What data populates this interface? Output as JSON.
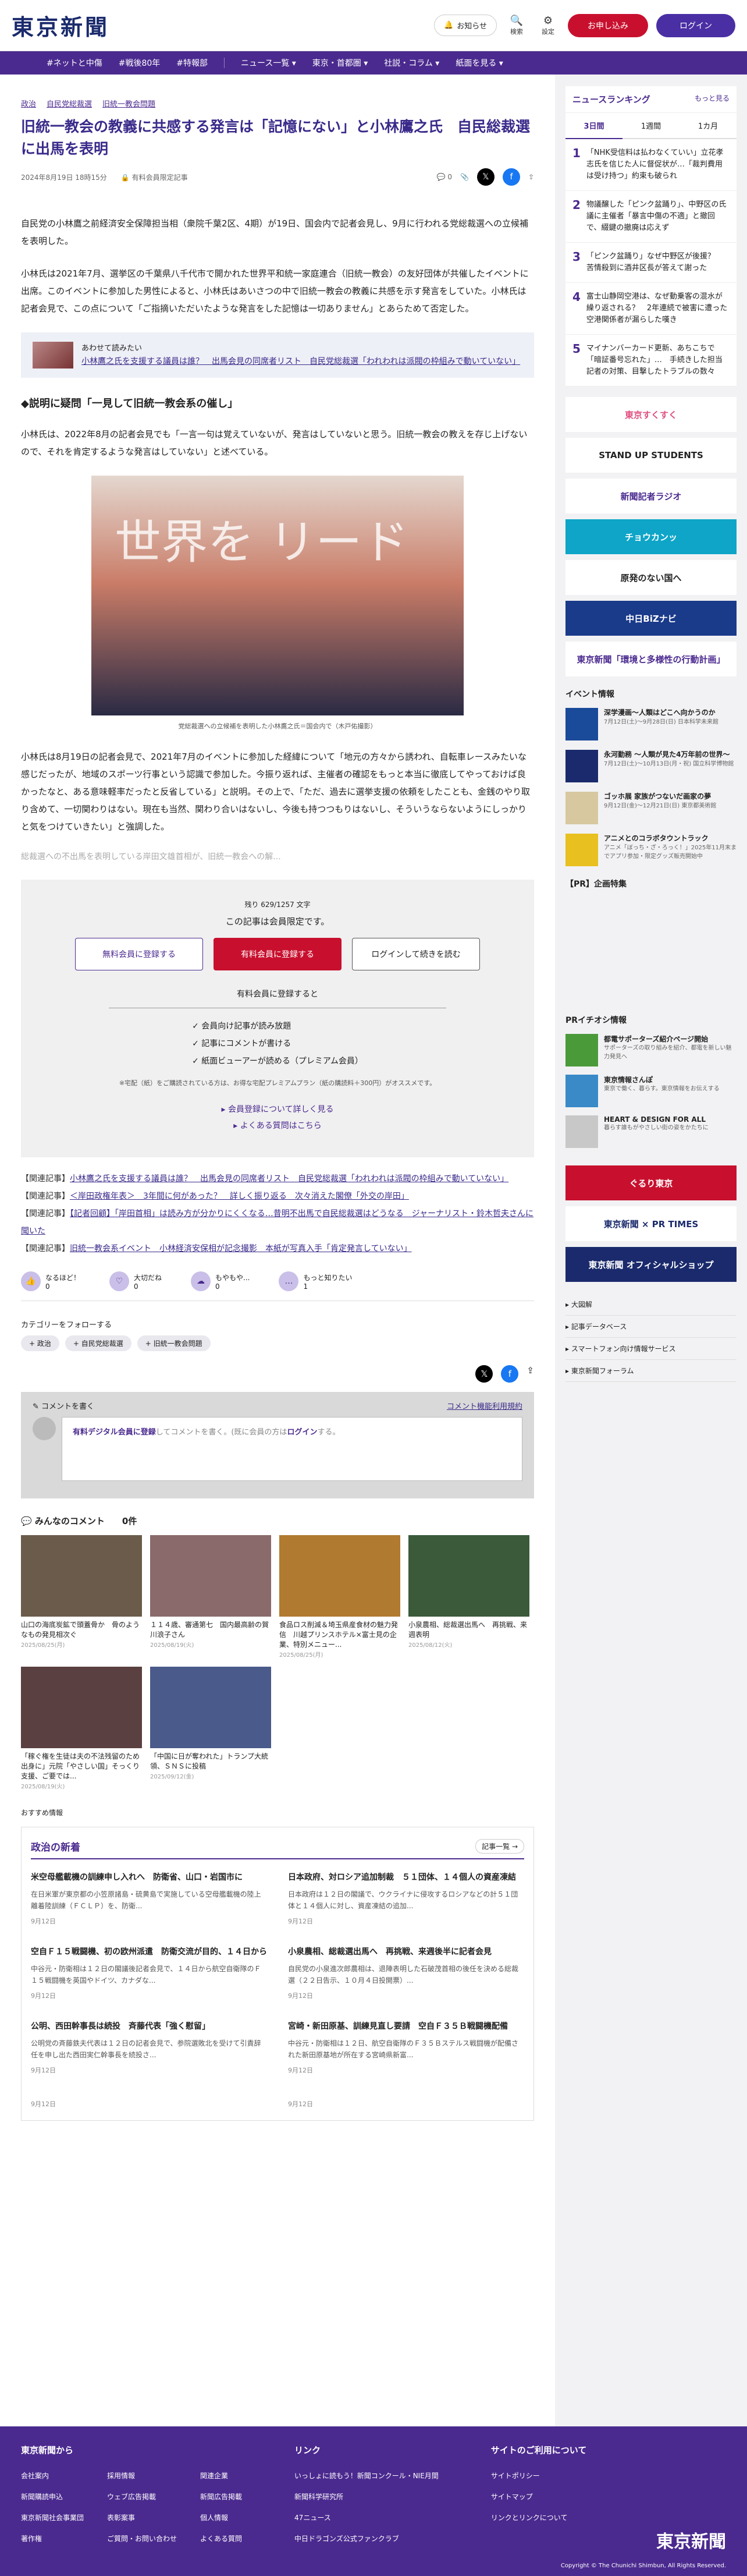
{
  "header": {
    "logo": "東京新聞",
    "notice_btn": "お知らせ",
    "search_label": "検索",
    "settings_label": "設定",
    "subscribe_btn": "お申し込み",
    "login_btn": "ログイン"
  },
  "nav": [
    "#ネットと中傷",
    "#戦後80年",
    "#特報部",
    "ニュース一覧 ▾",
    "東京・首都圏 ▾",
    "社説・コラム ▾",
    "紙面を見る ▾"
  ],
  "breadcrumb": [
    "政治",
    "自民党総裁選",
    "旧統一教会問題"
  ],
  "article": {
    "title": "旧統一教会の教義に共感する発言は「記憶にない」と小林鷹之氏　自民総裁選に出馬を表明",
    "date": "2024年8月19日 18時15分",
    "member_only": "有料会員限定記事",
    "comment_count": "0",
    "p1": "自民党の小林鷹之前経済安全保障担当相（衆院千葉2区、4期）が19日、国会内で記者会見し、9月に行われる党総裁選への立候補を表明した。",
    "p2": "小林氏は2021年7月、選挙区の千葉県八千代市で開かれた世界平和統一家庭連合（旧統一教会）の友好団体が共催したイベントに出席。このイベントに参加した男性によると、小林氏はあいさつの中で旧統一教会の教義に共感を示す発言をしていた。小林氏は記者会見で、この点について「ご指摘いただいたような発言をした記憶は一切ありません」とあらためて否定した。",
    "related_box_title": "あわせて読みたい",
    "related_box_link": "小林鷹之氏を支援する議員は誰？　出馬会見の同席者リスト　自民党総裁選「われわれは派閥の枠組みで動いていない」",
    "subhead": "◆説明に疑問「一見して旧統一教会系の催し」",
    "p3": "小林氏は、2022年8月の記者会見でも「一言一句は覚えていないが、発言はしていないと思う。旧統一教会の教えを存じ上げないので、それを肯定するような発言はしていない」と述べている。",
    "photo_text": "世界を リード",
    "caption": "党総裁選への立候補を表明した小林鷹之氏＝国会内で（木戸佑撮影）",
    "p4": "小林氏は8月19日の記者会見で、2021年7月のイベントに参加した経緯について「地元の方々から誘われ、自転車レースみたいな感じだったが、地域のスポーツ行事という認識で参加した。今振り返れば、主催者の確認をもっと本当に徹底してやっておけば良かったなと、ある意味軽率だったと反省している」と説明。その上で、「ただ、過去に選挙支援の依頼をしたことも、金銭のやり取り含めて、一切関わりはない。現在も当然、関わり合いはないし、今後も持つつもりはないし、そういうならないようにしっかりと気をつけていきたい」と強調した。",
    "fade": "総裁選への不出馬を表明している岸田文雄首相が、旧統一教会への解..."
  },
  "paywall": {
    "count": "残り 629/1257 文字",
    "title": "この記事は会員限定です。",
    "btn_free": "無料会員に登録する",
    "btn_paid": "有料会員に登録する",
    "btn_login": "ログインして続きを読む",
    "sub": "有料会員に登録すると",
    "benefits": [
      "✓ 会員向け記事が読み放題",
      "✓ 記事にコメントが書ける",
      "✓ 紙面ビューアーが読める（プレミアム会員）"
    ],
    "note": "※宅配（紙）をご購読されている方は、お得な宅配プレミアムプラン（紙の購読料＋300円）がオススメです。",
    "link1": "▸ 会員登録について詳しく見る",
    "link2": "▸ よくある質問はこちら"
  },
  "related_list": [
    {
      "label": "【関連記事】",
      "text": "小林鷹之氏を支援する議員は誰？　出馬会見の同席者リスト　自民党総裁選「われわれは派閥の枠組みで動いていない」"
    },
    {
      "label": "【関連記事】",
      "text": "＜岸田政権年表＞　3年間に何があった？　詳しく振り返る　次々消えた閣僚「外交の岸田」"
    },
    {
      "label": "【関連記事】",
      "text": "【記者回顧】「岸田首相」は読み方が分かりにくくなる…昔明不出馬で自民総裁選はどうなる　ジャーナリスト・鈴木哲夫さんに聞いた"
    },
    {
      "label": "【関連記事】",
      "text": "旧統一教会系イベント　小林経済安保相が記念撮影　本紙が写真入手「肯定発言していない」"
    }
  ],
  "reactions": [
    {
      "icon": "👍",
      "label": "なるほど！",
      "count": "0"
    },
    {
      "icon": "♡",
      "label": "大切だね",
      "count": "0"
    },
    {
      "icon": "☁",
      "label": "もやもや...",
      "count": "0"
    },
    {
      "icon": "…",
      "label": "もっと知りたい",
      "count": "1"
    }
  ],
  "categories": {
    "title": "カテゴリーをフォローする",
    "tags": [
      "+ 政治",
      "+ 自民党総裁選",
      "+ 旧統一教会問題"
    ]
  },
  "comment_box": {
    "title": "コメントを書く",
    "rules_link": "コメント機能利用規約",
    "prompt_pre": "有料デジタル会員に登録",
    "prompt_post": "してコメントを書く。(既に会員の方は",
    "prompt_login": "ログイン",
    "prompt_end": "する。"
  },
  "comments_section": {
    "title": "みんなのコメント",
    "count": "0件"
  },
  "photo_cards": [
    {
      "caption": "山口の海底炭鉱で頭蓋骨か　骨のようなもの発見相次ぐ",
      "date": "2025/08/25(月)",
      "color": "#6b5b4a"
    },
    {
      "caption": "１１４歳、審通第七　国内最高齢の賀川浪子さん",
      "date": "2025/08/19(火)",
      "color": "#8a6a6a"
    },
    {
      "caption": "食品ロス削減＆埼玉県産食材の魅力発信　川越プリンスホテル×富士見の企業、特別メニュー...",
      "date": "2025/08/25(月)",
      "color": "#b07a30"
    },
    {
      "caption": "小泉農相、総裁選出馬へ　再挑戦、来週表明",
      "date": "2025/08/12(火)",
      "color": "#3a5a3a"
    },
    {
      "caption": "「稼ぐ権を生徒は夫の不法残留のため出身に」元院「やさしい国」そっくり支援、ご要では...",
      "date": "2025/08/19(火)",
      "color": "#5a4040"
    },
    {
      "caption": "「中国に日が奪われた」トランプ大統領、ＳＮＳに投稿",
      "date": "2025/09/12(金)",
      "color": "#4a5a8a"
    }
  ],
  "osusume": "おすすめ情報",
  "politics": {
    "title": "政治の新着",
    "more": "記事一覧 →",
    "items": [
      {
        "title": "米空母艦載機の訓練申し入れへ　防衛省、山口・岩国市に",
        "desc": "在日米軍が東京都の小笠原諸島・硫黄島で実施している空母艦載機の陸上離着陸訓練（ＦＣＬＰ）を、防衛...",
        "date": "9月12日"
      },
      {
        "title": "日本政府、対ロシア追加制裁　５１団体、１４個人の資産凍結",
        "desc": "日本政府は１２日の閣議で、ウクライナに侵攻するロシアなどの計５１団体と１４個人に対し、資産凍結の追加...",
        "date": "9月12日"
      },
      {
        "title": "空自Ｆ１５戦闘機、初の欧州派遣　防衛交流が目的、１４日から",
        "desc": "中谷元・防衛相は１２日の閣議後記者会見で、１４日から航空自衛隊のＦ１５戦闘機を英国やドイツ、カナダな...",
        "date": "9月12日"
      },
      {
        "title": "小泉農相、総裁選出馬へ　再挑戦、来週後半に記者会見",
        "desc": "自民党の小泉進次郎農相は、退陣表明した石破茂首相の後任を決める総裁選（２２日告示、１０月４日投開票）...",
        "date": "9月12日"
      },
      {
        "title": "公明、西田幹事長は続投　斉藤代表「強く慰留」",
        "desc": "公明党の斉藤鉄夫代表は１２日の記者会見で、参院選敗北を受けて引責辞任を申し出た西田実仁幹事長を続投さ...",
        "date": "9月12日"
      },
      {
        "title": "宮崎・新田原基、訓練見直し要請　空自Ｆ３５Ｂ戦闘機配備",
        "desc": "中谷元・防衛相は１２日、航空自衛隊のＦ３５Ｂステルス戦闘機が配備された新田原基地が所在する宮崎県新富...",
        "date": "9月12日"
      },
      {
        "title": "",
        "desc": "",
        "date": "9月12日"
      },
      {
        "title": "",
        "desc": "",
        "date": "9月12日"
      }
    ]
  },
  "sidebar": {
    "ranking_title": "ニュースランキング",
    "ranking_more": "もっと見る",
    "tabs": [
      "3日間",
      "1週間",
      "1カ月"
    ],
    "ranking": [
      {
        "n": "1",
        "t": "「NHK受信料は払わなくていい」立花孝志氏を信じた人に督促状が…「裁判費用は受け持つ」約束も破られ"
      },
      {
        "n": "2",
        "t": "物議醸した「ピンク盆踊り」、中野区の氏議に主催者「暴言中傷の不適」と撤回で、綴鍵の撤廃は応えず"
      },
      {
        "n": "3",
        "t": "「ピンク盆踊り」なぜ中野区が後援？　苦情殺到に酒井区長が答えて謝った"
      },
      {
        "n": "4",
        "t": "富士山静岡空港は、なぜ動乗客の混水が繰り返される？　2年連続で被害に遭った空港関係者が漏らした嘆き"
      },
      {
        "n": "5",
        "t": "マイナンバーカード更新、あちこちで「暗証番号忘れた」…　手続きした担当記者の対策、目撃したトラブルの数々"
      }
    ],
    "banners": [
      {
        "text": "東京すくすく",
        "bg": "#ffffff",
        "fg": "#e05080"
      },
      {
        "text": "STAND UP STUDENTS",
        "bg": "#ffffff",
        "fg": "#222222"
      },
      {
        "text": "新聞記者ラジオ",
        "bg": "#ffffff",
        "fg": "#4b2a8f"
      },
      {
        "text": "チョウカンッ",
        "bg": "#0ea5c8",
        "fg": "#ffffff"
      },
      {
        "text": "原発のない国へ",
        "bg": "#ffffff",
        "fg": "#222222"
      },
      {
        "text": "中日BiZナビ",
        "bg": "#1a3a8a",
        "fg": "#ffffff"
      },
      {
        "text": "東京新聞「環境と多様性の行動計画」",
        "bg": "#ffffff",
        "fg": "#4b2a8f"
      }
    ],
    "events_title": "イベント情報",
    "events": [
      {
        "t": "深学漫画〜人類はどこへ向かうのか",
        "d": "7月12日(土)〜9月28日(日) 日本科学未来館",
        "color": "#1a4a9a"
      },
      {
        "t": "永河勤務 〜人類が見た4万年前の世界〜",
        "d": "7月12日(土)〜10月13日(月・祝) 国立科学博物館",
        "color": "#1a2a6c"
      },
      {
        "t": "ゴッホ展 家族がつないだ画家の夢",
        "d": "9月12日(金)〜12月21日(日) 東京都美術館",
        "color": "#d8c8a0"
      },
      {
        "t": "アニメとのコラボタウントラック",
        "d": "アニメ「ぼっち・ざ・ろっく！」2025年11月末までアプリ参加・限定グッズ販売開始中",
        "color": "#e8c020"
      }
    ],
    "pr_title": "【PR】企画特集",
    "pr_info_title": "PRイチオシ情報",
    "pr_info": [
      {
        "t": "都電サポーターズ紹介ページ開始",
        "d": "サポーターズの取り組みを紹介、都電を新しい魅力発見へ",
        "color": "#4b9a3a"
      },
      {
        "t": "東京情報さんぽ",
        "d": "東京で働く、暮らす。東京情報をお伝えする",
        "color": "#3a8ac8"
      },
      {
        "t": "HEART & DESIGN FOR ALL",
        "d": "暮らす誰もがやさしい街の姿をかたちに",
        "color": "#c8c8c8"
      }
    ],
    "banners2": [
      {
        "text": "ぐるり東京",
        "bg": "#c8102e",
        "fg": "#ffffff"
      },
      {
        "text": "東京新聞 × PR TIMES",
        "bg": "#ffffff",
        "fg": "#1a2a6c"
      },
      {
        "text": "東京新聞 オフィシャルショップ",
        "bg": "#1a2a6c",
        "fg": "#ffffff"
      }
    ],
    "links": [
      "▸ 大図解",
      "▸ 記事データベース",
      "▸ スマートフォン向け情報サービス",
      "▸ 東京新聞フォーラム"
    ]
  },
  "footer": {
    "col1_title": "東京新聞から",
    "col1_a": [
      "会社案内",
      "新聞購読申込",
      "東京新聞社会事業団",
      "著作権"
    ],
    "col1_b": [
      "採用情報",
      "ウェブ広告掲載",
      "表彰案事",
      "ご質問・お問い合わせ"
    ],
    "col1_c": [
      "関連企業",
      "新聞広告掲載",
      "個人情報",
      "よくある質問"
    ],
    "col2_title": "リンク",
    "col2": [
      "いっしょに読もう！新聞コンクール・NIE月間",
      "新聞科学研究所",
      "47ニュース",
      "中日ドラゴンズ公式ファンクラブ"
    ],
    "col3_title": "サイトのご利用について",
    "col3": [
      "サイトポリシー",
      "サイトマップ",
      "リンクとリンクについて"
    ],
    "logo": "東京新聞",
    "copyright": "Copyright © The Chunichi Shimbun, All Rights Reserved."
  }
}
